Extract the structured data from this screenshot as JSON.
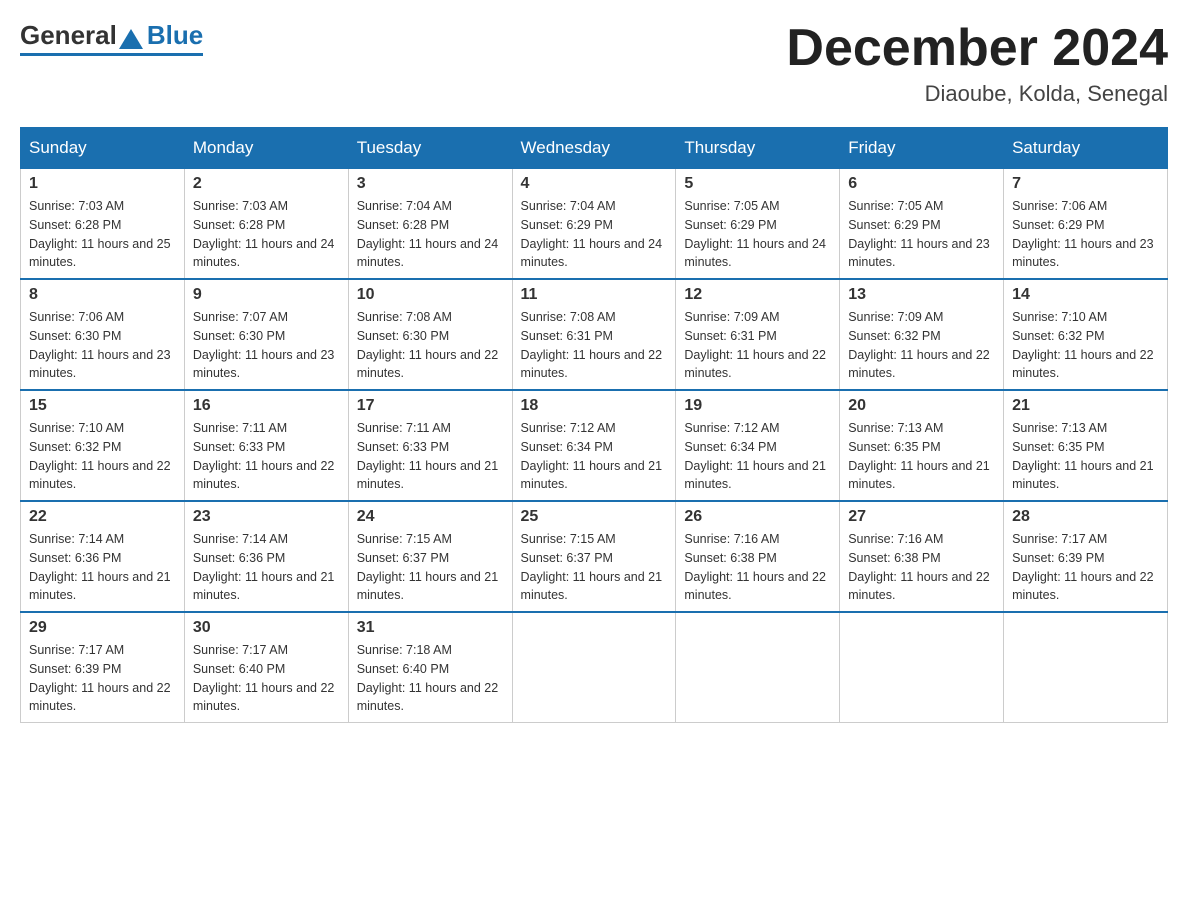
{
  "header": {
    "logo_general": "General",
    "logo_blue": "Blue",
    "month_title": "December 2024",
    "location": "Diaoube, Kolda, Senegal"
  },
  "days_of_week": [
    "Sunday",
    "Monday",
    "Tuesday",
    "Wednesday",
    "Thursday",
    "Friday",
    "Saturday"
  ],
  "weeks": [
    [
      {
        "day": "1",
        "sunrise": "7:03 AM",
        "sunset": "6:28 PM",
        "daylight": "11 hours and 25 minutes."
      },
      {
        "day": "2",
        "sunrise": "7:03 AM",
        "sunset": "6:28 PM",
        "daylight": "11 hours and 24 minutes."
      },
      {
        "day": "3",
        "sunrise": "7:04 AM",
        "sunset": "6:28 PM",
        "daylight": "11 hours and 24 minutes."
      },
      {
        "day": "4",
        "sunrise": "7:04 AM",
        "sunset": "6:29 PM",
        "daylight": "11 hours and 24 minutes."
      },
      {
        "day": "5",
        "sunrise": "7:05 AM",
        "sunset": "6:29 PM",
        "daylight": "11 hours and 24 minutes."
      },
      {
        "day": "6",
        "sunrise": "7:05 AM",
        "sunset": "6:29 PM",
        "daylight": "11 hours and 23 minutes."
      },
      {
        "day": "7",
        "sunrise": "7:06 AM",
        "sunset": "6:29 PM",
        "daylight": "11 hours and 23 minutes."
      }
    ],
    [
      {
        "day": "8",
        "sunrise": "7:06 AM",
        "sunset": "6:30 PM",
        "daylight": "11 hours and 23 minutes."
      },
      {
        "day": "9",
        "sunrise": "7:07 AM",
        "sunset": "6:30 PM",
        "daylight": "11 hours and 23 minutes."
      },
      {
        "day": "10",
        "sunrise": "7:08 AM",
        "sunset": "6:30 PM",
        "daylight": "11 hours and 22 minutes."
      },
      {
        "day": "11",
        "sunrise": "7:08 AM",
        "sunset": "6:31 PM",
        "daylight": "11 hours and 22 minutes."
      },
      {
        "day": "12",
        "sunrise": "7:09 AM",
        "sunset": "6:31 PM",
        "daylight": "11 hours and 22 minutes."
      },
      {
        "day": "13",
        "sunrise": "7:09 AM",
        "sunset": "6:32 PM",
        "daylight": "11 hours and 22 minutes."
      },
      {
        "day": "14",
        "sunrise": "7:10 AM",
        "sunset": "6:32 PM",
        "daylight": "11 hours and 22 minutes."
      }
    ],
    [
      {
        "day": "15",
        "sunrise": "7:10 AM",
        "sunset": "6:32 PM",
        "daylight": "11 hours and 22 minutes."
      },
      {
        "day": "16",
        "sunrise": "7:11 AM",
        "sunset": "6:33 PM",
        "daylight": "11 hours and 22 minutes."
      },
      {
        "day": "17",
        "sunrise": "7:11 AM",
        "sunset": "6:33 PM",
        "daylight": "11 hours and 21 minutes."
      },
      {
        "day": "18",
        "sunrise": "7:12 AM",
        "sunset": "6:34 PM",
        "daylight": "11 hours and 21 minutes."
      },
      {
        "day": "19",
        "sunrise": "7:12 AM",
        "sunset": "6:34 PM",
        "daylight": "11 hours and 21 minutes."
      },
      {
        "day": "20",
        "sunrise": "7:13 AM",
        "sunset": "6:35 PM",
        "daylight": "11 hours and 21 minutes."
      },
      {
        "day": "21",
        "sunrise": "7:13 AM",
        "sunset": "6:35 PM",
        "daylight": "11 hours and 21 minutes."
      }
    ],
    [
      {
        "day": "22",
        "sunrise": "7:14 AM",
        "sunset": "6:36 PM",
        "daylight": "11 hours and 21 minutes."
      },
      {
        "day": "23",
        "sunrise": "7:14 AM",
        "sunset": "6:36 PM",
        "daylight": "11 hours and 21 minutes."
      },
      {
        "day": "24",
        "sunrise": "7:15 AM",
        "sunset": "6:37 PM",
        "daylight": "11 hours and 21 minutes."
      },
      {
        "day": "25",
        "sunrise": "7:15 AM",
        "sunset": "6:37 PM",
        "daylight": "11 hours and 21 minutes."
      },
      {
        "day": "26",
        "sunrise": "7:16 AM",
        "sunset": "6:38 PM",
        "daylight": "11 hours and 22 minutes."
      },
      {
        "day": "27",
        "sunrise": "7:16 AM",
        "sunset": "6:38 PM",
        "daylight": "11 hours and 22 minutes."
      },
      {
        "day": "28",
        "sunrise": "7:17 AM",
        "sunset": "6:39 PM",
        "daylight": "11 hours and 22 minutes."
      }
    ],
    [
      {
        "day": "29",
        "sunrise": "7:17 AM",
        "sunset": "6:39 PM",
        "daylight": "11 hours and 22 minutes."
      },
      {
        "day": "30",
        "sunrise": "7:17 AM",
        "sunset": "6:40 PM",
        "daylight": "11 hours and 22 minutes."
      },
      {
        "day": "31",
        "sunrise": "7:18 AM",
        "sunset": "6:40 PM",
        "daylight": "11 hours and 22 minutes."
      },
      null,
      null,
      null,
      null
    ]
  ]
}
